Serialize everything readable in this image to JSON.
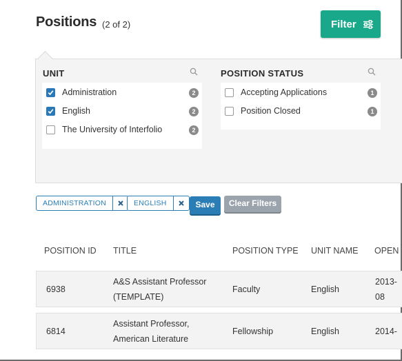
{
  "header": {
    "title": "Positions",
    "count": "(2 of 2)",
    "filter_label": "Filter"
  },
  "filters": {
    "unit": {
      "title": "UNIT",
      "items": [
        {
          "label": "Administration",
          "count": "2",
          "checked": true
        },
        {
          "label": "English",
          "count": "2",
          "checked": true
        },
        {
          "label": "The University of Interfolio",
          "count": "2",
          "checked": false
        }
      ]
    },
    "status": {
      "title": "POSITION STATUS",
      "items": [
        {
          "label": "Accepting Applications",
          "count": "1",
          "checked": false
        },
        {
          "label": "Position Closed",
          "count": "1",
          "checked": false
        }
      ]
    }
  },
  "active_filters": {
    "chips": [
      "ADMINISTRATION",
      "ENGLISH"
    ],
    "save_label": "Save",
    "clear_label": "Clear Filters"
  },
  "table": {
    "headers": [
      "POSITION ID",
      "TITLE",
      "POSITION TYPE",
      "UNIT NAME",
      "OPEN"
    ],
    "rows": [
      {
        "id": "6938",
        "title_line1": "A&S Assistant Professor",
        "title_line2": "(TEMPLATE)",
        "type": "Faculty",
        "unit": "English",
        "open_line1": "2013-",
        "open_line2": "08"
      },
      {
        "id": "6814",
        "title_line1": "Assistant Professor,",
        "title_line2": "American Literature",
        "type": "Fellowship",
        "unit": "English",
        "open_line1": "2014-",
        "open_line2": ""
      }
    ]
  },
  "colors": {
    "accent_green": "#19a889",
    "accent_blue": "#2a7db5",
    "checkbox_blue": "#2a78b7",
    "clear_gray": "#9ba4ac"
  }
}
